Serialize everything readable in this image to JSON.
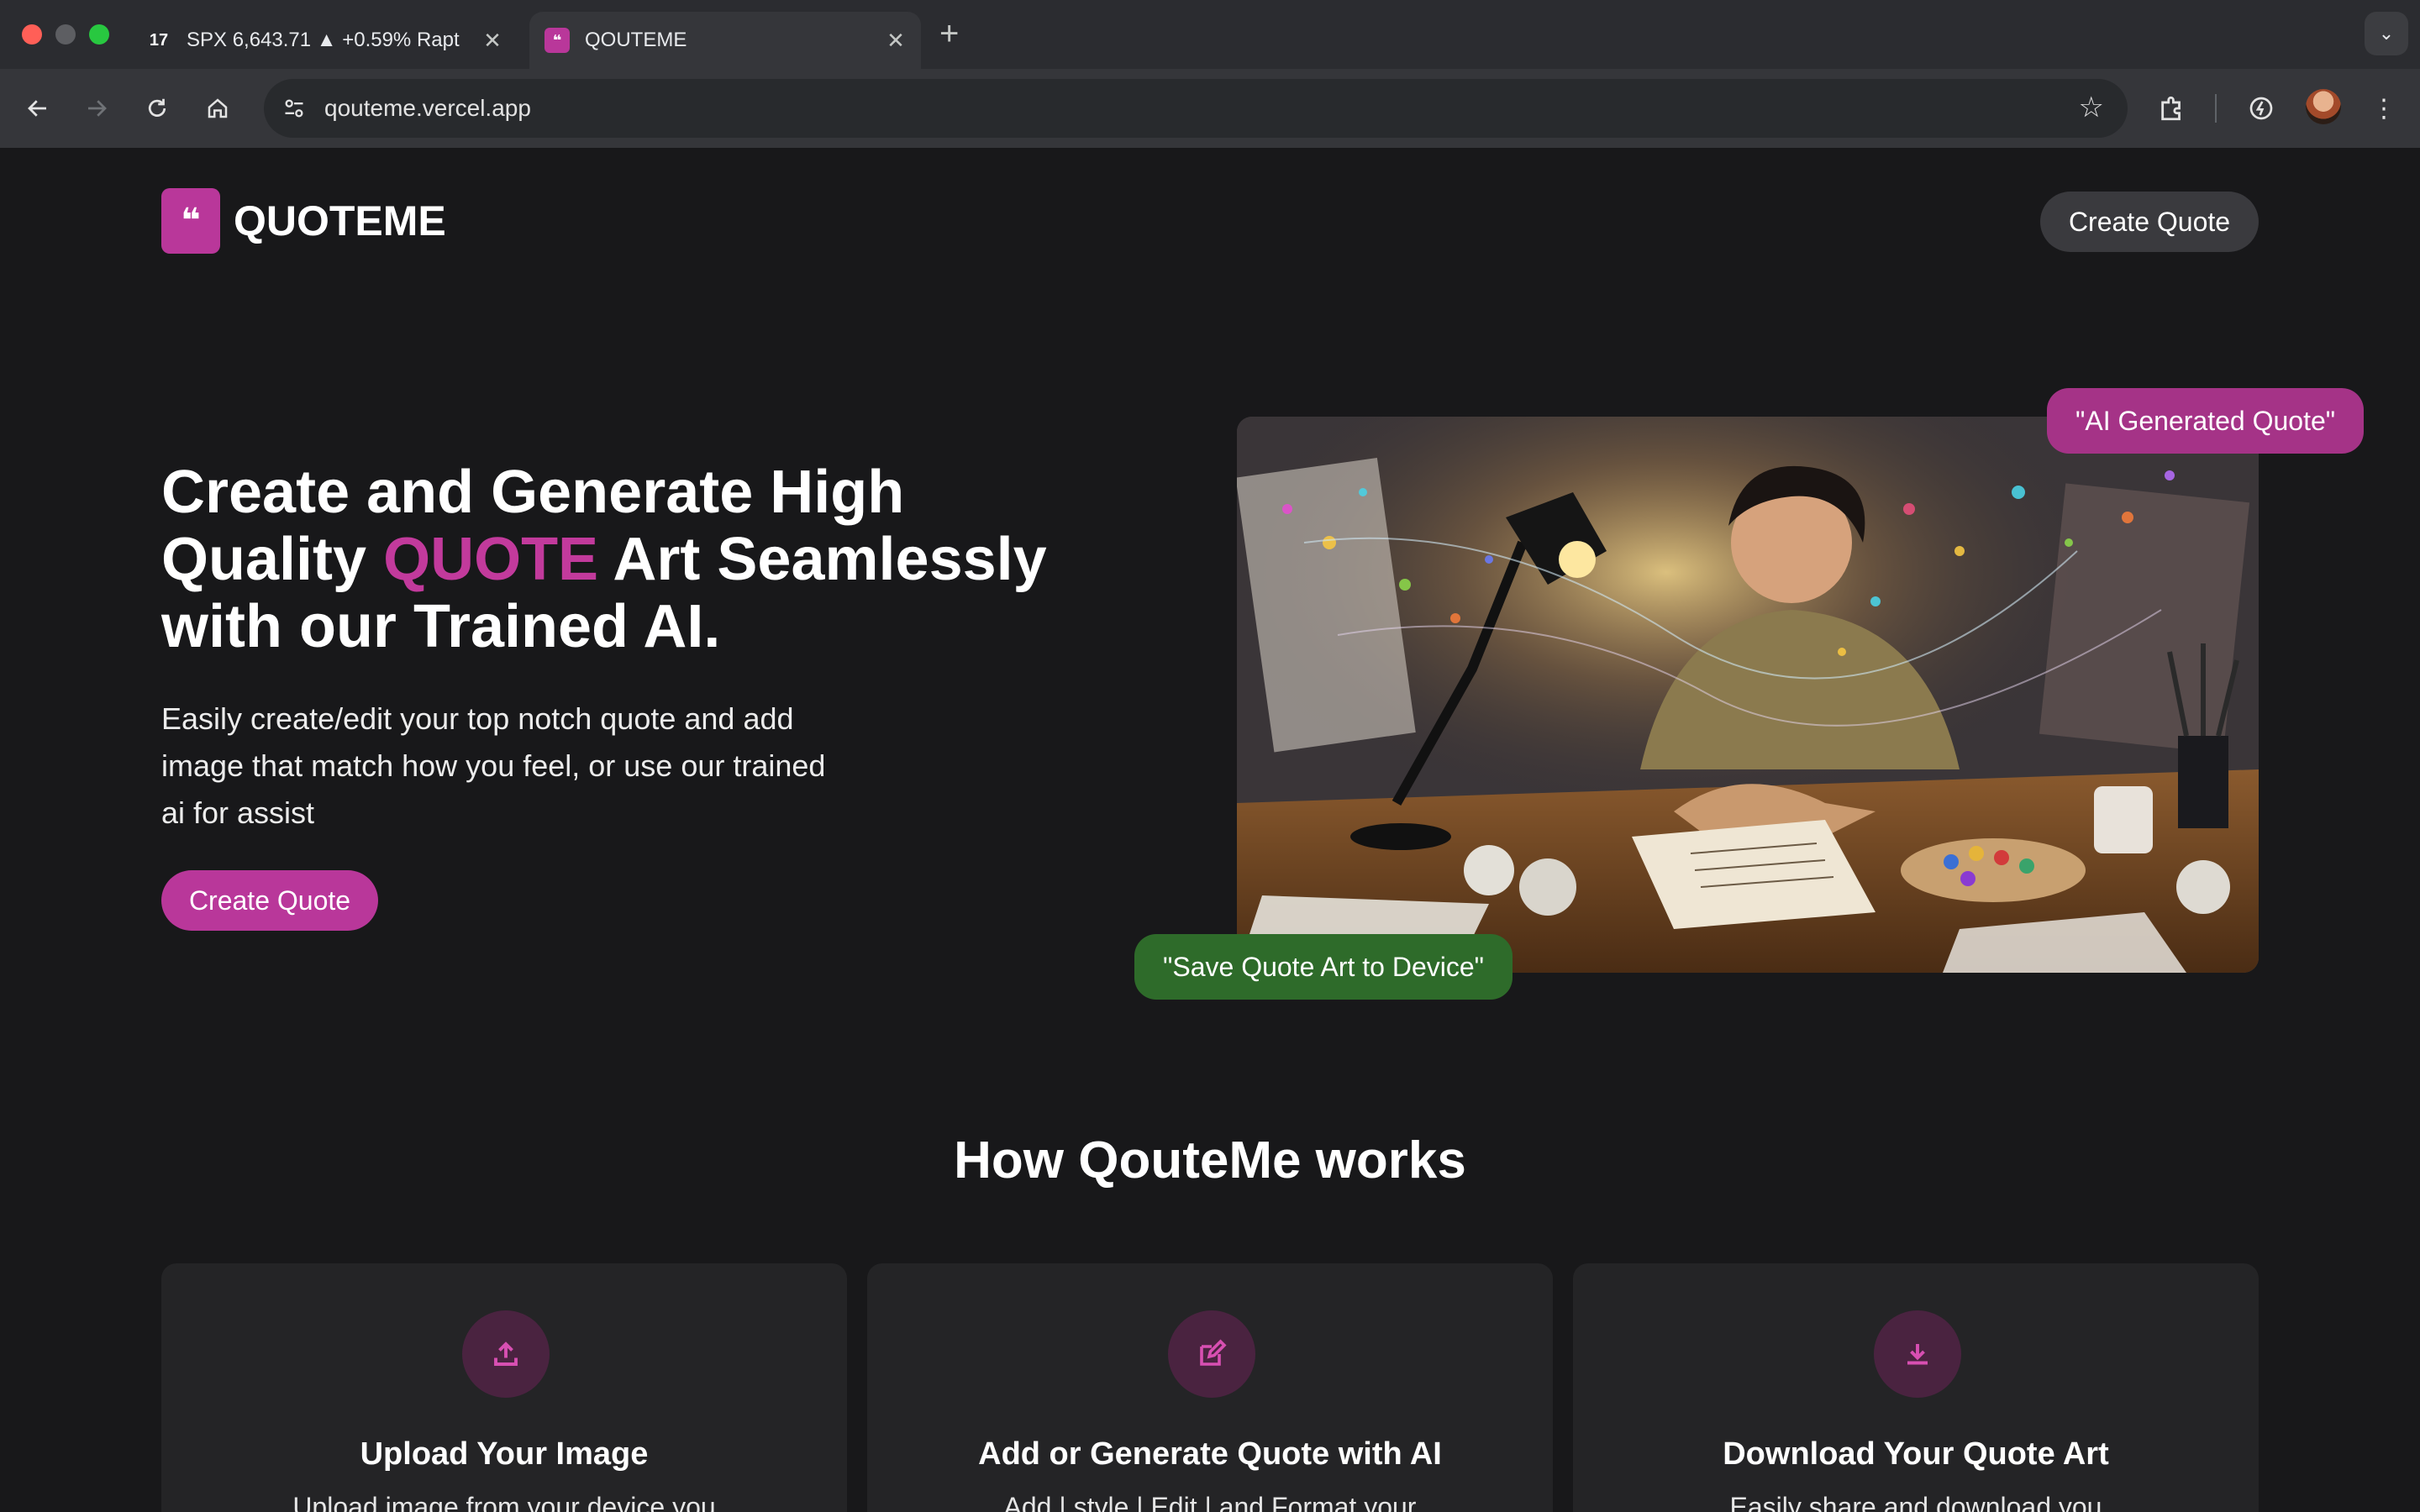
{
  "browser": {
    "tabs": [
      {
        "title": "SPX 6,643.71 ▲ +0.59% Rapt",
        "favicon": "tradingview-icon",
        "active": false
      },
      {
        "title": "QOUTEME",
        "favicon": "quoteme-icon",
        "active": true
      }
    ],
    "url": "qouteme.vercel.app"
  },
  "header": {
    "logo_glyph": "❝",
    "logo_text": "QUOTEME",
    "cta_label": "Create Quote"
  },
  "hero": {
    "title_line1": "Create and Generate High",
    "title_line2_pre": "Quality ",
    "title_accent": "QUOTE",
    "title_line2_post": " Art Seamlessly",
    "title_line3": "with our Trained AI.",
    "subtitle": "Easily create/edit your top notch quote and add image that match how you feel, or use our trained ai for assist",
    "cta_label": "Create Quote",
    "bubble_ai": "\"AI Generated Quote\"",
    "bubble_save": "\"Save Quote Art to Device\""
  },
  "how": {
    "title": "How QouteMe works",
    "cards": [
      {
        "icon": "upload-icon",
        "title": "Upload Your Image",
        "desc": "Upload image from your device you"
      },
      {
        "icon": "edit-icon",
        "title": "Add or Generate Quote with AI",
        "desc": "Add | style | Edit | and Format your"
      },
      {
        "icon": "download-icon",
        "title": "Download Your Quote Art",
        "desc": "Easily share and download you"
      }
    ]
  },
  "colors": {
    "accent": "#c23a9c",
    "background": "#18181a",
    "save_bubble": "#2e6b2a"
  }
}
